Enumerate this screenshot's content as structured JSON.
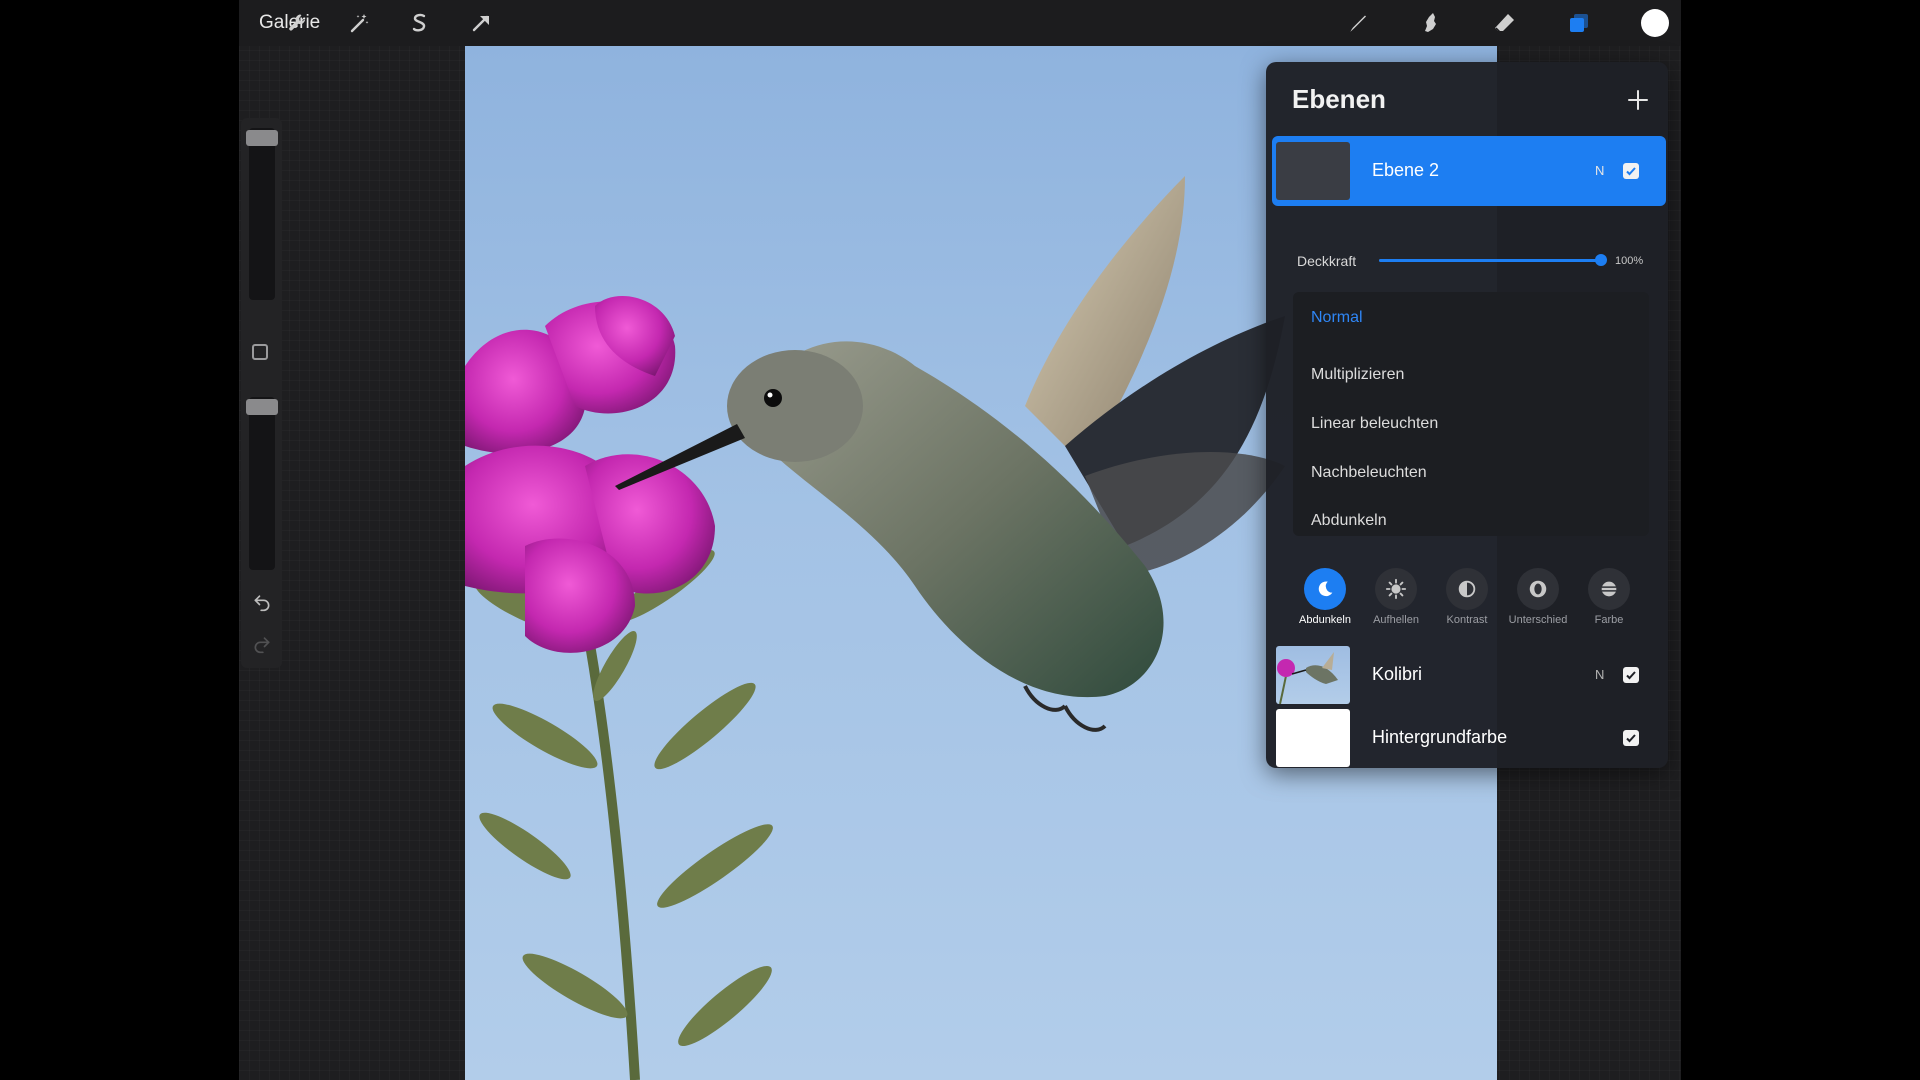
{
  "toolbar": {
    "gallery_label": "Galerie",
    "left_tools": [
      "wrench-icon",
      "magic-wand-icon",
      "selection-icon",
      "transform-arrow-icon"
    ],
    "right_tools": [
      "brush-icon",
      "smudge-icon",
      "eraser-icon",
      "layers-icon"
    ],
    "current_color": "#ffffff",
    "accent_color": "#1d7ef2"
  },
  "sidebar": {
    "brush_size_slider": "slider",
    "modify_button": "square",
    "opacity_slider": "slider",
    "undo_icon": "undo-icon",
    "redo_icon": "redo-icon"
  },
  "layers_panel": {
    "title": "Ebenen",
    "add_icon": "plus-icon",
    "active_layer": {
      "name": "Ebene 2",
      "mode": "N",
      "visible": true
    },
    "opacity": {
      "label": "Deckkraft",
      "value": "100%",
      "level": 1.0
    },
    "blend_modes": [
      "Normal",
      "Multiplizieren",
      "Linear beleuchten",
      "Nachbeleuchten",
      "Abdunkeln"
    ],
    "selected_blend_mode": "Normal",
    "categories": [
      {
        "label": "Abdunkeln",
        "icon": "moon-icon",
        "active": true
      },
      {
        "label": "Aufhellen",
        "icon": "sun-icon",
        "active": false
      },
      {
        "label": "Kontrast",
        "icon": "contrast-icon",
        "active": false
      },
      {
        "label": "Unterschied",
        "icon": "difference-icon",
        "active": false
      },
      {
        "label": "Farbe",
        "icon": "color-icon",
        "active": false
      }
    ],
    "layers": [
      {
        "name": "Kolibri",
        "mode": "N",
        "visible": true
      },
      {
        "name": "Hintergrundfarbe",
        "mode": "",
        "visible": true
      }
    ]
  }
}
